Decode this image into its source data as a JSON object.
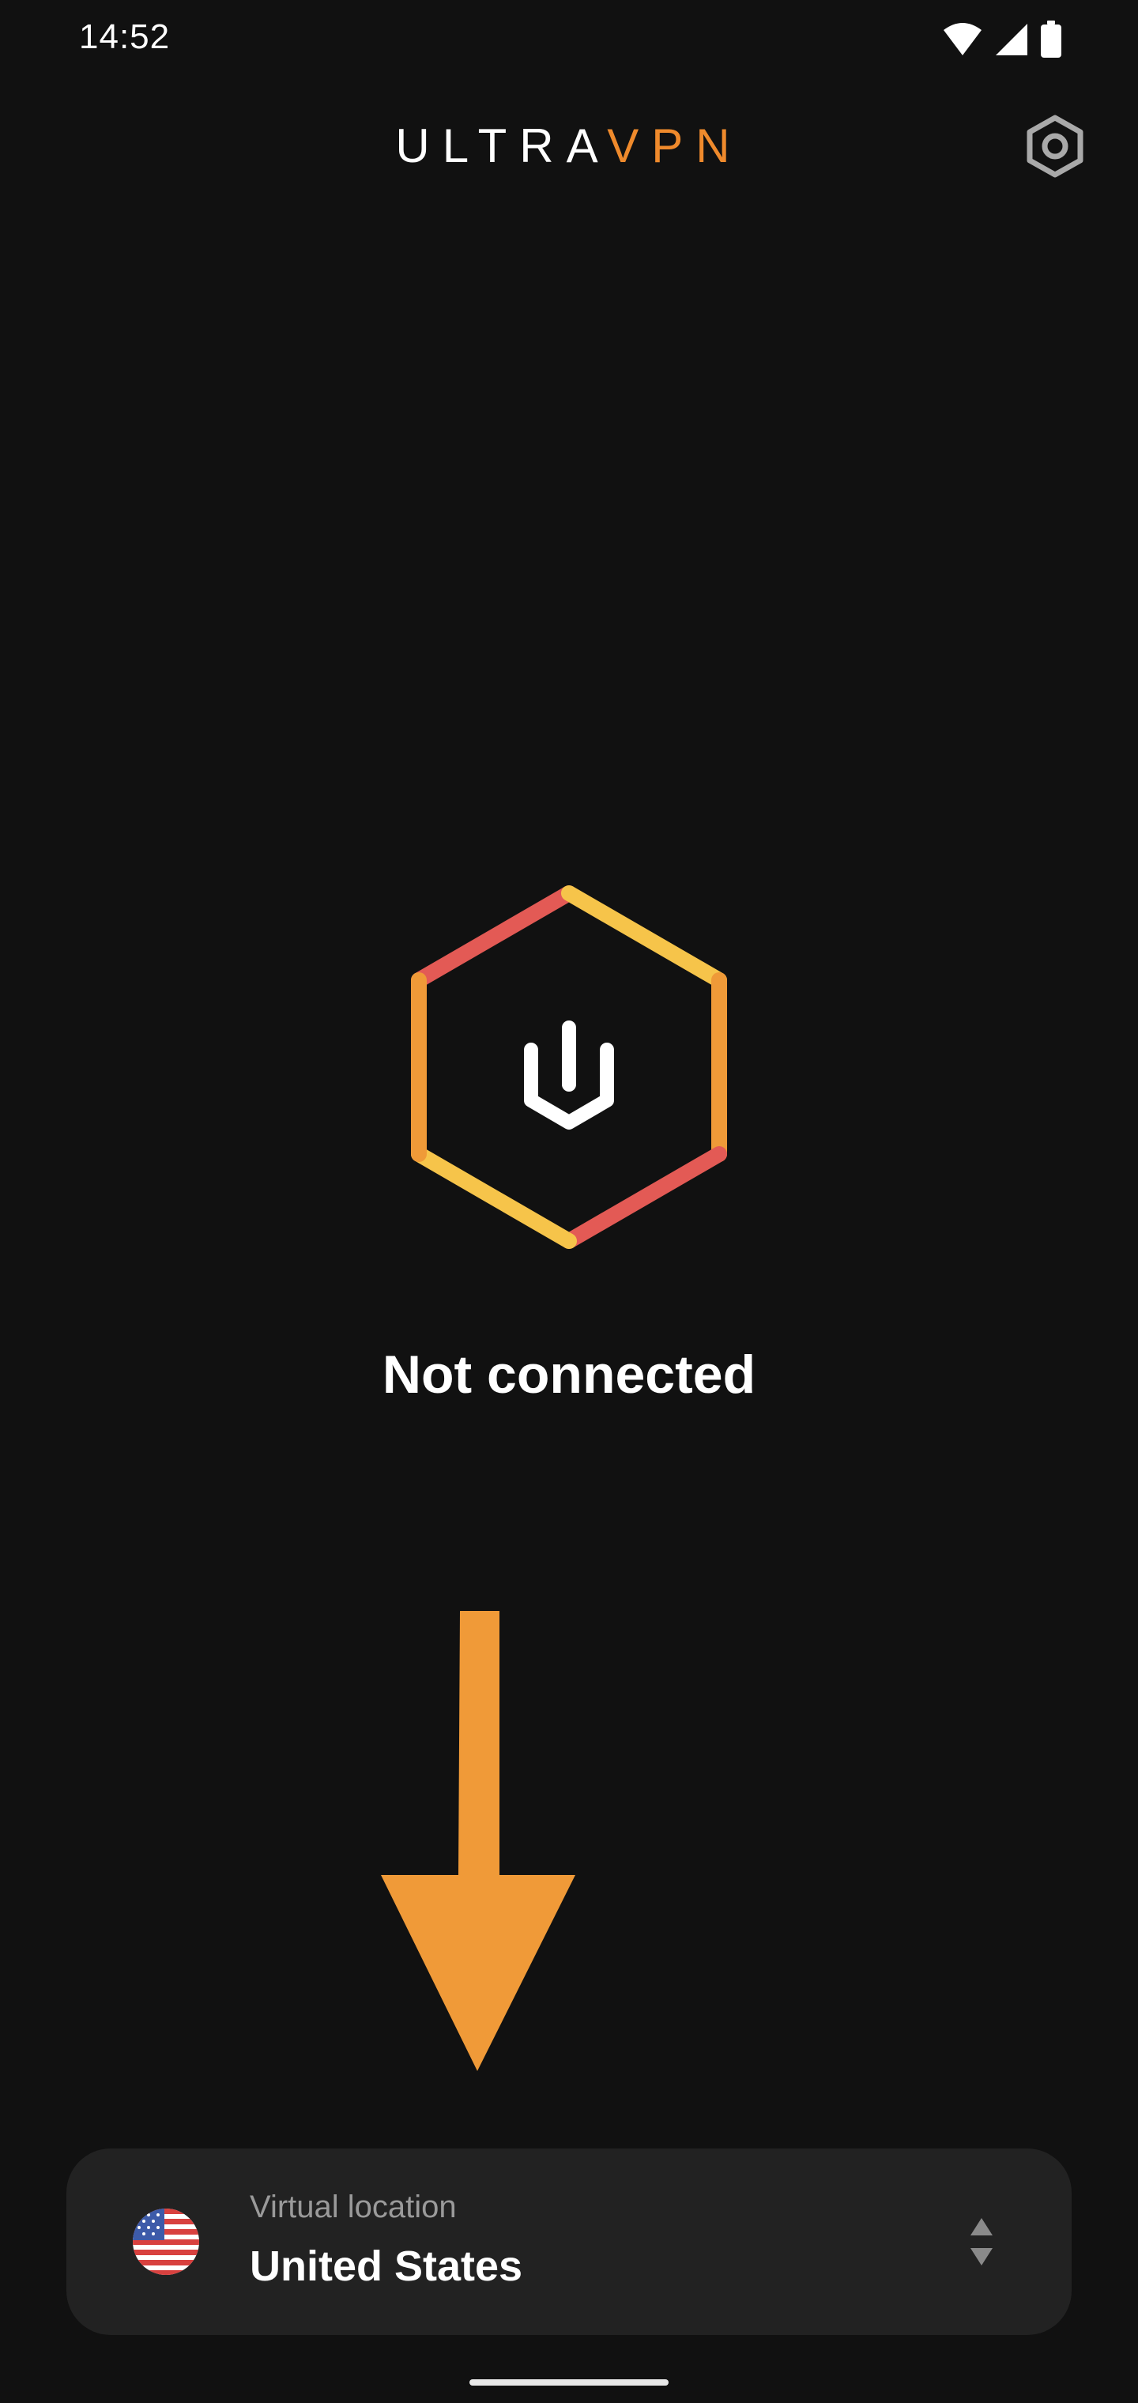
{
  "status_bar": {
    "time": "14:52",
    "icons": [
      "wifi-icon",
      "signal-icon",
      "battery-icon"
    ]
  },
  "header": {
    "logo_primary": "ULTRA",
    "logo_accent": "VPN",
    "settings_icon": "settings-hexagon-icon"
  },
  "connection": {
    "status": "Not connected",
    "button_icon": "power-icon"
  },
  "location": {
    "caption": "Virtual location",
    "country": "United States",
    "flag_icon": "us-flag-icon",
    "selector_icon": "expand-chevrons-icon"
  },
  "colors": {
    "background": "#111111",
    "card": "#222222",
    "accent_orange": "#ef8a2c",
    "hex_red": "#e35a55",
    "hex_yellow": "#f6c44a",
    "hex_orange": "#ef9a38",
    "arrow": "#f09a38"
  }
}
